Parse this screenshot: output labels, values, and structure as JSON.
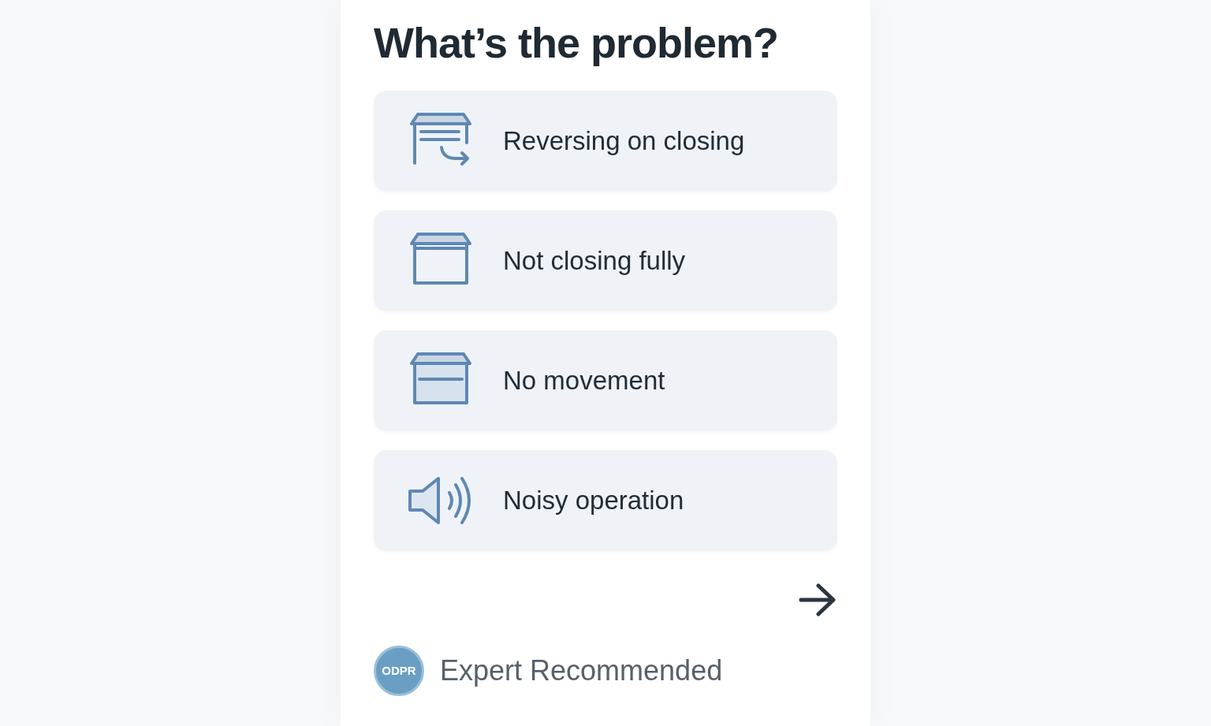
{
  "title": "What’s the problem?",
  "options": [
    {
      "label": "Reversing on closing",
      "kind": "reverse"
    },
    {
      "label": "Not closing fully",
      "kind": "partial"
    },
    {
      "label": "No movement",
      "kind": "closed"
    },
    {
      "label": "Noisy operation",
      "kind": "sound"
    }
  ],
  "footer": {
    "badge": "ODPR",
    "text": "Expert Recommended"
  }
}
